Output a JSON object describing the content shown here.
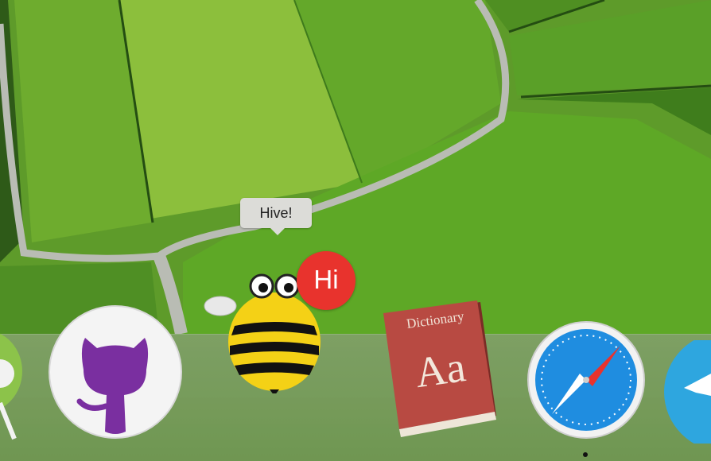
{
  "hive_tooltip": {
    "text": "Hive!"
  },
  "hive_badge": {
    "text": "Hi"
  },
  "dictionary_icon": {
    "title": "Dictionary",
    "letters": "Aa"
  },
  "dock": {
    "items": [
      {
        "icon": "android-studio-icon"
      },
      {
        "icon": "github-desktop-icon"
      },
      {
        "icon": "hive-bee-icon"
      },
      {
        "icon": "dictionary-icon"
      },
      {
        "icon": "safari-icon"
      },
      {
        "icon": "telegram-icon"
      }
    ]
  },
  "colors": {
    "badge": "#e8332d",
    "bee_yellow": "#f4d116",
    "dictionary_red": "#b84a42",
    "safari_blue": "#1f8de0",
    "telegram_blue": "#2ea6df"
  }
}
